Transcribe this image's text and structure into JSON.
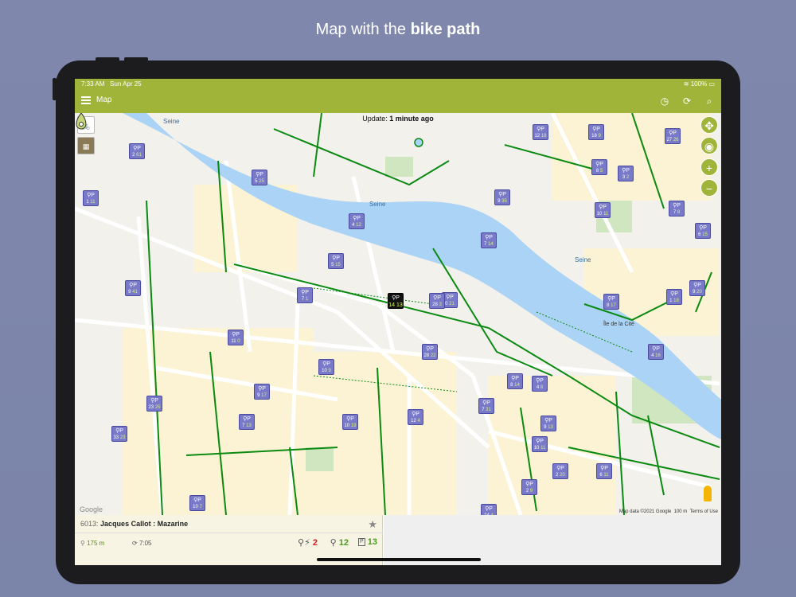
{
  "caption": {
    "prefix": "Map with the ",
    "bold": "bike path"
  },
  "status": {
    "time": "7:33 AM",
    "date": "Sun Apr 25",
    "battery": "100%"
  },
  "appbar": {
    "title": "Map",
    "timer_icon": "timer-icon",
    "refresh_icon": "refresh-icon",
    "search_icon": "search-icon"
  },
  "map": {
    "update_label": "Update:",
    "update_value": "1 minute ago",
    "google": "Google",
    "mapdata": "Map data ©2021 Google",
    "scale": "100 m",
    "terms": "Terms of Use",
    "controls": {
      "move": "✥",
      "locate": "◉",
      "zoom_in": "+",
      "zoom_out": "−"
    },
    "layers": {
      "bike": "🚲",
      "satellite": "▦"
    },
    "river_label_1": "Seine",
    "river_label_2": "Seine",
    "river_label_3": "Seine",
    "island_label": "Île de la Cité"
  },
  "markers": [
    {
      "a": "1",
      "b": "11"
    },
    {
      "a": "2",
      "b": "61"
    },
    {
      "a": "5",
      "b": "25"
    },
    {
      "a": "4",
      "b": "12"
    },
    {
      "a": "5",
      "b": "15"
    },
    {
      "a": "7",
      "b": "1"
    },
    {
      "a": "9",
      "b": "41"
    },
    {
      "a": "11",
      "b": "0"
    },
    {
      "a": "10",
      "b": "9"
    },
    {
      "a": "9",
      "b": "17"
    },
    {
      "a": "7",
      "b": "13"
    },
    {
      "a": "23",
      "b": "25"
    },
    {
      "a": "33",
      "b": "23"
    },
    {
      "a": "10",
      "b": "19"
    },
    {
      "a": "28",
      "b": "22"
    },
    {
      "a": "0",
      "b": "21"
    },
    {
      "a": "28",
      "b": "3"
    },
    {
      "a": "12",
      "b": "18"
    },
    {
      "a": "18",
      "b": "9"
    },
    {
      "a": "27",
      "b": "26"
    },
    {
      "a": "8",
      "b": "5"
    },
    {
      "a": "3",
      "b": "2"
    },
    {
      "a": "9",
      "b": "35"
    },
    {
      "a": "10",
      "b": "11"
    },
    {
      "a": "7",
      "b": "8"
    },
    {
      "a": "6",
      "b": "15"
    },
    {
      "a": "7",
      "b": "14"
    },
    {
      "a": "8",
      "b": "17"
    },
    {
      "a": "1",
      "b": "18"
    },
    {
      "a": "9",
      "b": "20"
    },
    {
      "a": "8",
      "b": "14"
    },
    {
      "a": "4",
      "b": "8"
    },
    {
      "a": "9",
      "b": "13"
    },
    {
      "a": "2",
      "b": "20"
    },
    {
      "a": "10",
      "b": "11"
    },
    {
      "a": "7",
      "b": "31"
    },
    {
      "a": "12",
      "b": "4"
    },
    {
      "a": "6",
      "b": "11"
    },
    {
      "a": "24",
      "b": "4"
    },
    {
      "a": "4",
      "b": "16"
    },
    {
      "a": "2",
      "b": "9"
    },
    {
      "a": "10",
      "b": "7"
    }
  ],
  "selected_marker": {
    "a": "14",
    "b": "13"
  },
  "detail": {
    "station_id": "6013:",
    "station_name": "Jacques Callot : Mazarine",
    "distance": "175 m",
    "updated": "7:05",
    "ebikes": "2",
    "bikes": "12",
    "docks": "13",
    "docks_label": "P"
  }
}
